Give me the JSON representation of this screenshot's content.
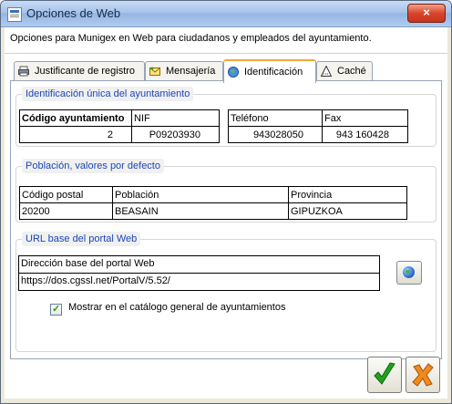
{
  "window": {
    "title": "Opciones de Web",
    "close_glyph": "×"
  },
  "description": "Opciones para Munigex en Web para ciudadanos y empleados del ayuntamiento.",
  "tabs": [
    {
      "label": "Justificante de registro",
      "icon": "printer-icon"
    },
    {
      "label": "Mensajería",
      "icon": "mail-icon"
    },
    {
      "label": "Identificación",
      "icon": "globe-icon",
      "active": true
    },
    {
      "label": "Caché",
      "icon": "cache-icon"
    }
  ],
  "identification": {
    "title": "Identificación única del ayuntamiento",
    "headers": {
      "code": "Código ayuntamiento",
      "nif": "NIF",
      "phone": "Teléfono",
      "fax": "Fax"
    },
    "values": {
      "code": "2",
      "nif": "P09203930",
      "phone": "943028050",
      "fax": "943 160428"
    }
  },
  "population": {
    "title": "Población, valores por defecto",
    "headers": {
      "postal": "Código postal",
      "town": "Población",
      "province": "Provincia"
    },
    "values": {
      "postal": "20200",
      "town": "BEASAIN",
      "province": "GIPUZKOA"
    }
  },
  "url": {
    "title": "URL base del portal Web",
    "label": "Dirección base del portal Web",
    "value": "https://dos.cgssl.net/PortalV/5.52/"
  },
  "show_catalog": {
    "label": "Mostrar en el catálogo general de ayuntamientos",
    "checked": true
  },
  "colors": {
    "group_title": "#1b46b8",
    "active_tab_accent": "#f2a73a",
    "ok_green": "#21a121",
    "cancel_orange": "#f08a1c"
  }
}
